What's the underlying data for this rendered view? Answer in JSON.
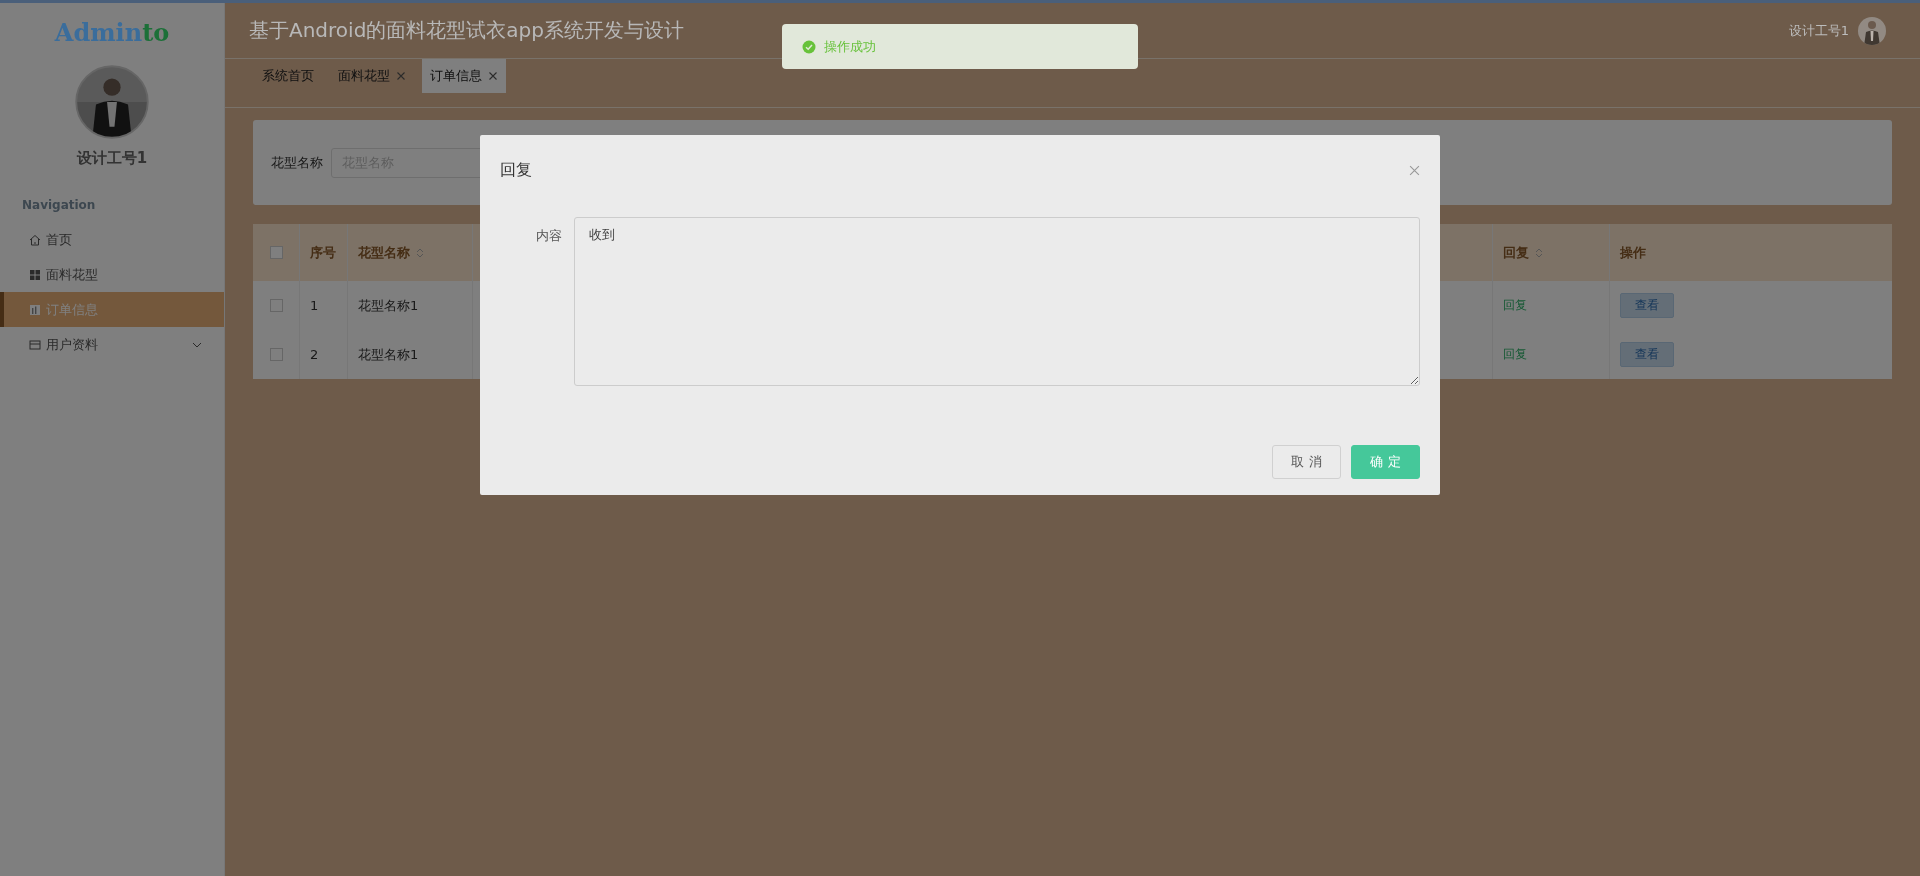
{
  "sidebar": {
    "logo": [
      {
        "text": "Admin",
        "color": "#3a6d9c"
      },
      {
        "text": "to",
        "color": "#1c7038"
      }
    ],
    "user_name": "设计工号1",
    "section": "Navigation",
    "items": [
      {
        "label": "首页",
        "kind": "home",
        "selected": false,
        "expandable": false
      },
      {
        "label": "面料花型",
        "kind": "grid",
        "selected": false,
        "expandable": false
      },
      {
        "label": "订单信息",
        "kind": "chart",
        "selected": true,
        "expandable": false
      },
      {
        "label": "用户资料",
        "kind": "card",
        "selected": false,
        "expandable": true
      }
    ]
  },
  "header": {
    "title": "基于Android的面料花型试衣app系统开发与设计",
    "user": "设计工号1"
  },
  "tabs": [
    {
      "label": "系统首页",
      "closable": false,
      "selected": false
    },
    {
      "label": "面料花型",
      "closable": true,
      "selected": false
    },
    {
      "label": "订单信息",
      "closable": true,
      "selected": true
    }
  ],
  "search": {
    "label": "花型名称",
    "placeholder": "花型名称"
  },
  "table": {
    "all_checked": false,
    "left_columns": [
      {
        "label": "序号",
        "sortable": false
      },
      {
        "label": "花型名称",
        "sortable": true
      }
    ],
    "right_columns": [
      {
        "label": "回复",
        "sortable": true
      },
      {
        "label": "操作",
        "sortable": false
      }
    ],
    "rows": [
      {
        "checked": false,
        "index": "1",
        "name": "花型名称1",
        "reply": "回复",
        "action": "查看"
      },
      {
        "checked": false,
        "index": "2",
        "name": "花型名称1",
        "reply": "回复",
        "action": "查看"
      }
    ]
  },
  "toast": {
    "message": "操作成功"
  },
  "dialog": {
    "title": "回复",
    "field_label": "内容",
    "value": "收到",
    "buttons": [
      {
        "label": "取 消",
        "kind": "default"
      },
      {
        "label": "确 定",
        "kind": "primary"
      }
    ]
  }
}
